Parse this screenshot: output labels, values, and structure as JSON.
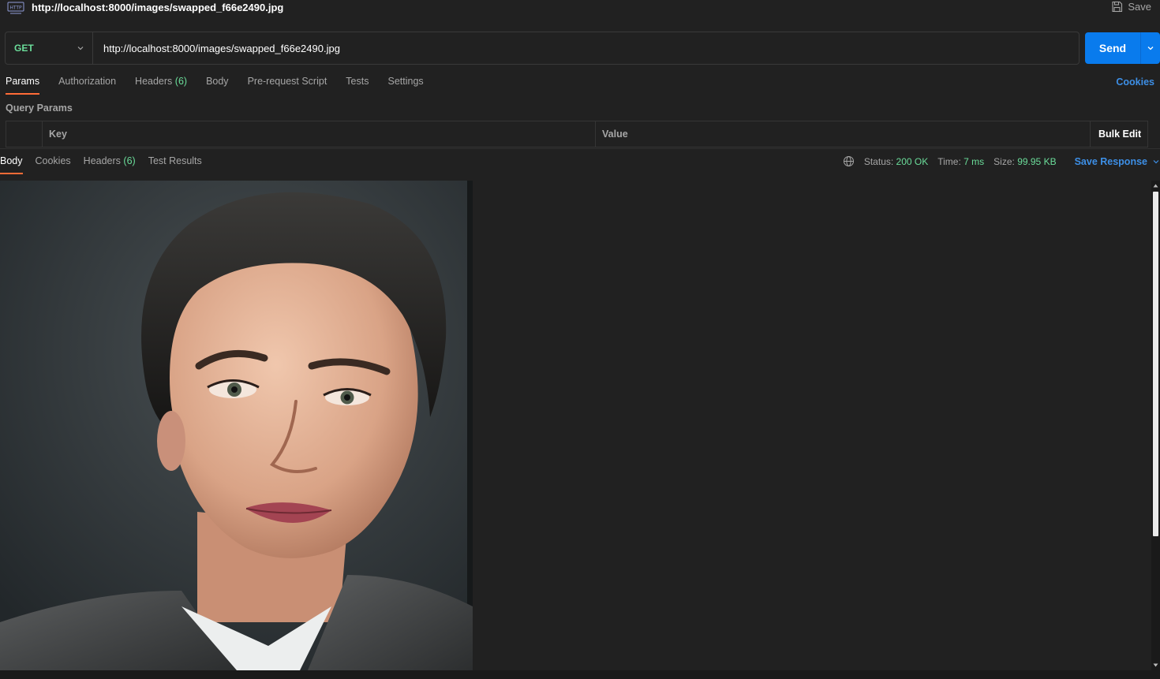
{
  "header": {
    "title": "http://localhost:8000/images/swapped_f66e2490.jpg",
    "http_icon_text": "HTTP",
    "save_label": "Save"
  },
  "request": {
    "method": "GET",
    "url": "http://localhost:8000/images/swapped_f66e2490.jpg",
    "send_label": "Send"
  },
  "request_tabs": [
    {
      "label": "Params"
    },
    {
      "label": "Authorization"
    },
    {
      "label": "Headers",
      "count": "(6)"
    },
    {
      "label": "Body"
    },
    {
      "label": "Pre-request Script"
    },
    {
      "label": "Tests"
    },
    {
      "label": "Settings"
    }
  ],
  "cookies_label": "Cookies",
  "query_params": {
    "title": "Query Params",
    "key_header": "Key",
    "value_header": "Value",
    "bulk_edit_label": "Bulk Edit"
  },
  "response_tabs": [
    {
      "label": "Body"
    },
    {
      "label": "Cookies"
    },
    {
      "label": "Headers",
      "count": "(6)"
    },
    {
      "label": "Test Results"
    }
  ],
  "response_status": {
    "status_label": "Status:",
    "status_value": "200 OK",
    "time_label": "Time:",
    "time_value": "7 ms",
    "size_label": "Size:",
    "size_value": "99.95 KB",
    "save_response_label": "Save Response"
  },
  "colors": {
    "accent_blue": "#097bed",
    "link_blue": "#3d8fe6",
    "success_green": "#6bdd9a",
    "active_tab_underline": "#ff6c37",
    "background": "#212121"
  }
}
